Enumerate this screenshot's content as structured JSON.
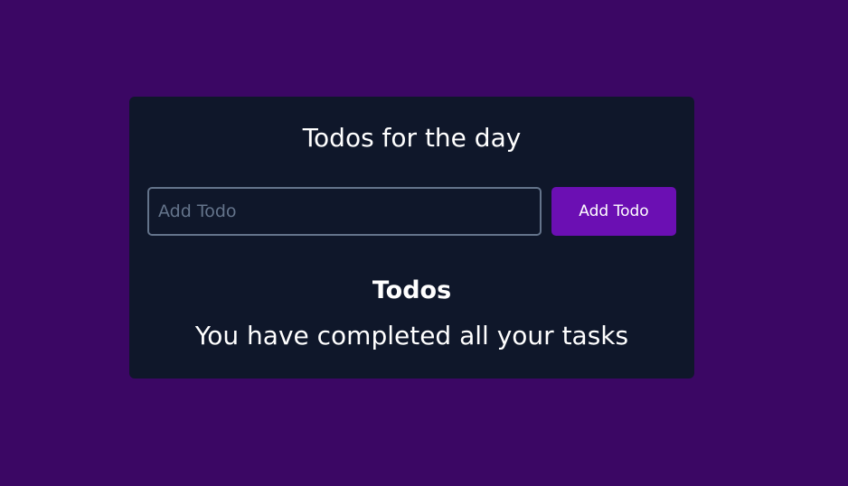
{
  "card": {
    "title": "Todos for the day",
    "input": {
      "placeholder": "Add Todo",
      "value": ""
    },
    "add_button_label": "Add Todo",
    "list_heading": "Todos",
    "empty_message": "You have completed all your tasks"
  },
  "colors": {
    "page_background": "#3b0764",
    "card_background": "#0f172a",
    "button_background": "#6b0fb3",
    "input_border": "#64748b"
  }
}
